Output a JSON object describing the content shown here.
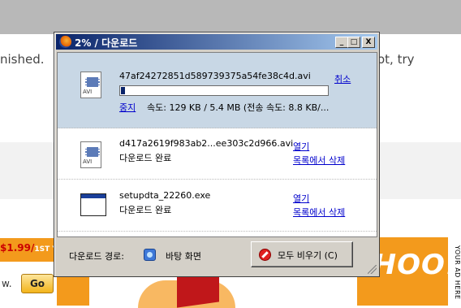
{
  "background": {
    "left_text": "nished.",
    "right_text": "ot, try"
  },
  "ad": {
    "price": "$1.99/",
    "price_sup": "1ST Y",
    "w_text": "w.",
    "go_label": "Go",
    "yahoo_text": "YAHOO!",
    "vertical_label": "YOUR AD HERE"
  },
  "window": {
    "title": "2% / 다운로드",
    "minimize": "_",
    "maximize": "□",
    "close": "X"
  },
  "downloads": [
    {
      "filename": "47af24272851d589739375a54fe38c4d.avi",
      "cancel_label": "취소",
      "pause_label": "중지",
      "speed_text": "속도: 129 KB / 5.4 MB (전송 속도: 8.8 KB/...",
      "progress": 0.02,
      "icon": "avi-file-icon"
    },
    {
      "filename": "d417a2619f983ab2...ee303c2d966.avi",
      "status": "다운로드 완료",
      "open_label": "열기",
      "remove_label": "목록에서 삭제",
      "icon": "avi-file-icon"
    },
    {
      "filename": "setupdta_22260.exe",
      "status": "다운로드 완료",
      "open_label": "열기",
      "remove_label": "목록에서 삭제",
      "icon": "exe-window-icon"
    }
  ],
  "footer": {
    "path_label": "다운로드 경로:",
    "path_value": "바탕 화면",
    "clear_button": "모두 비우기 (C)"
  },
  "colors": {
    "title_start": "#0a246a",
    "title_end": "#a6caf0",
    "selected_row": "#c8d7e5",
    "progress": "#0a246a",
    "link": "#0000cc"
  }
}
